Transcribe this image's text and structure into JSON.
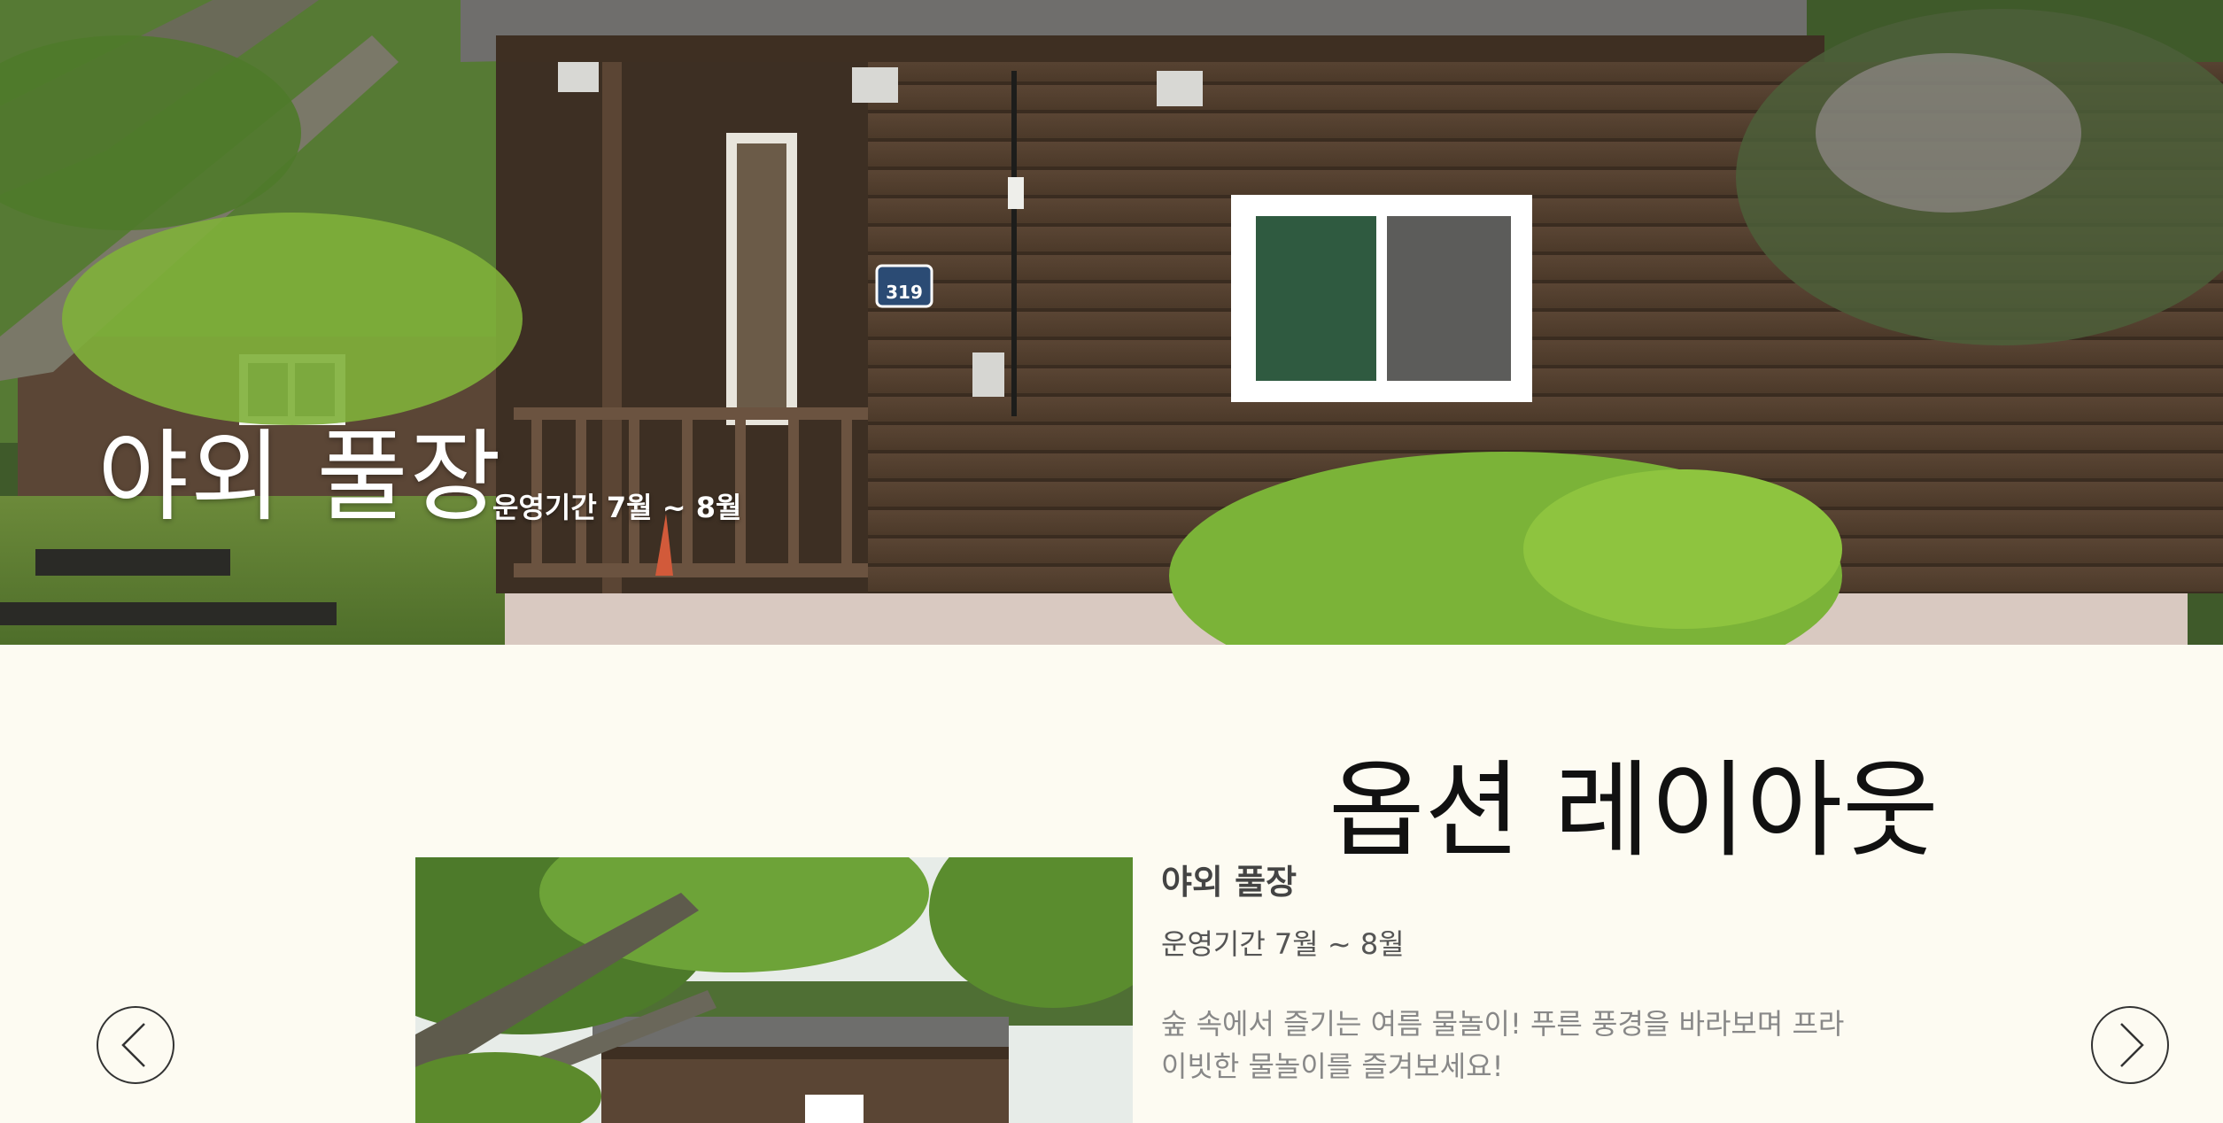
{
  "hero": {
    "title": "야외 풀장",
    "subtitle": "운영기간 7월 ~ 8월",
    "cabin_number": "319"
  },
  "section": {
    "title": "옵션 레이아웃"
  },
  "option": {
    "name": "야외 풀장",
    "period": "운영기간 7월 ~ 8월",
    "description": "숲 속에서 즐기는 여름 물놀이! 푸른 풍경을 바라보며 프라이빗한 물놀이를 즐겨보세요!"
  },
  "icons": {
    "prev": "chevron-left-icon",
    "next": "chevron-right-icon"
  },
  "colors": {
    "background": "#fdfbf2",
    "text_dark": "#111111",
    "text_muted": "#888888"
  }
}
